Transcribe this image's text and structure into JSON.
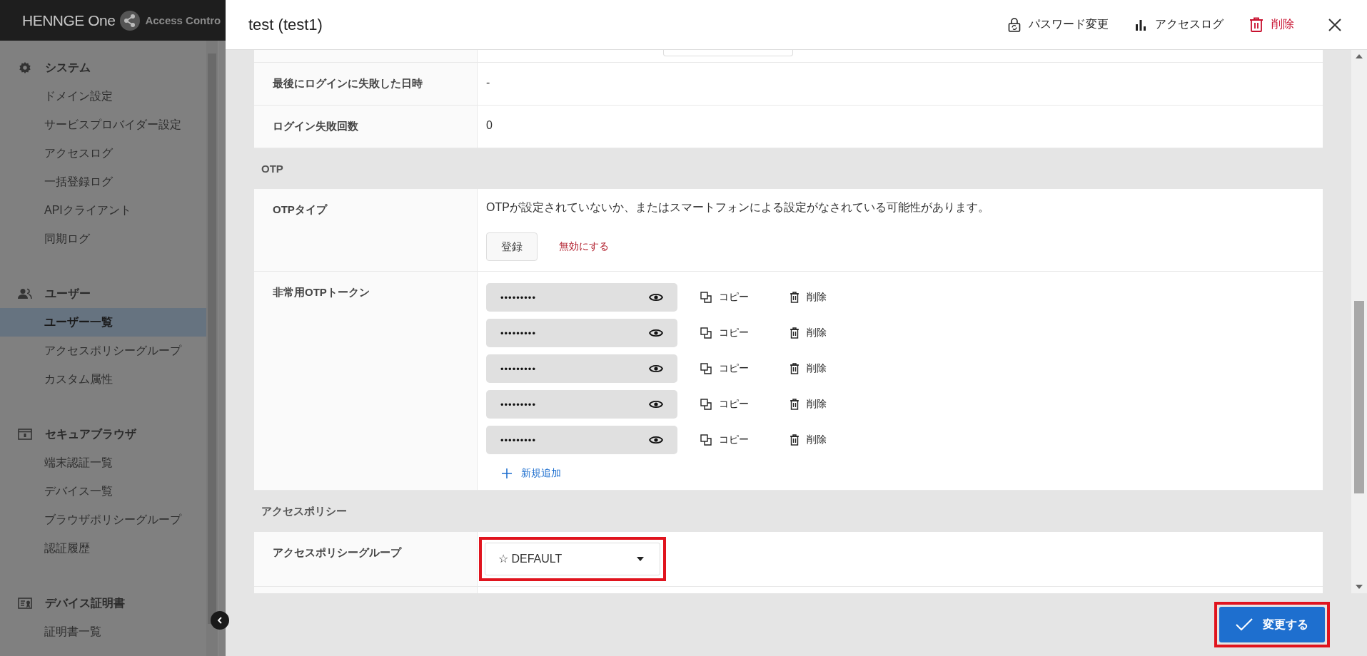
{
  "app": {
    "logo": "HENNGE One",
    "product": "Access Contro"
  },
  "sidebar": {
    "sections": [
      {
        "title": "システム",
        "kind": "gear",
        "items": [
          {
            "label": "ドメイン設定",
            "selected": false
          },
          {
            "label": "サービスプロバイダー設定",
            "selected": false
          },
          {
            "label": "アクセスログ",
            "selected": false
          },
          {
            "label": "一括登録ログ",
            "selected": false
          },
          {
            "label": "APIクライアント",
            "selected": false
          },
          {
            "label": "同期ログ",
            "selected": false
          }
        ]
      },
      {
        "title": "ユーザー",
        "kind": "people",
        "items": [
          {
            "label": "ユーザー一覧",
            "selected": true
          },
          {
            "label": "アクセスポリシーグループ",
            "selected": false
          },
          {
            "label": "カスタム属性",
            "selected": false
          }
        ]
      },
      {
        "title": "セキュアブラウザ",
        "kind": "browser",
        "items": [
          {
            "label": "端末認証一覧",
            "selected": false
          },
          {
            "label": "デバイス一覧",
            "selected": false
          },
          {
            "label": "ブラウザポリシーグループ",
            "selected": false
          },
          {
            "label": "認証履歴",
            "selected": false
          }
        ]
      },
      {
        "title": "デバイス証明書",
        "kind": "certificate",
        "items": [
          {
            "label": "証明書一覧",
            "selected": false
          }
        ]
      }
    ]
  },
  "drawer": {
    "title": "test (test1)",
    "actions": [
      {
        "kind": "password",
        "label": "パスワード変更"
      },
      {
        "kind": "log",
        "label": "アクセスログ"
      },
      {
        "kind": "delete",
        "label": "削除"
      }
    ]
  },
  "rows": [
    {
      "label": "最後にログインに失敗した日時",
      "value": "-"
    },
    {
      "label": "ログイン失敗回数",
      "value": "0"
    }
  ],
  "otp": {
    "title": "OTP",
    "type_label": "OTPタイプ",
    "type_text": "OTPが設定されていないか、またはスマートフォンによる設定がなされている可能性があります。",
    "register_button": "登録",
    "disable_link": "無効にする",
    "tokens_label": "非常用OTPトークン",
    "tokens": [
      {
        "value": "•••••••••",
        "copy": "コピー",
        "delete": "削除"
      },
      {
        "value": "•••••••••",
        "copy": "コピー",
        "delete": "削除"
      },
      {
        "value": "•••••••••",
        "copy": "コピー",
        "delete": "削除"
      },
      {
        "value": "•••••••••",
        "copy": "コピー",
        "delete": "削除"
      },
      {
        "value": "•••••••••",
        "copy": "コピー",
        "delete": "削除"
      }
    ],
    "add_link": "新規追加"
  },
  "access_policy": {
    "title": "アクセスポリシー",
    "group_label": "アクセスポリシーグループ",
    "group_value": "☆ DEFAULT",
    "highlighted": true
  },
  "submit": {
    "label": "変更する",
    "highlighted": true
  }
}
